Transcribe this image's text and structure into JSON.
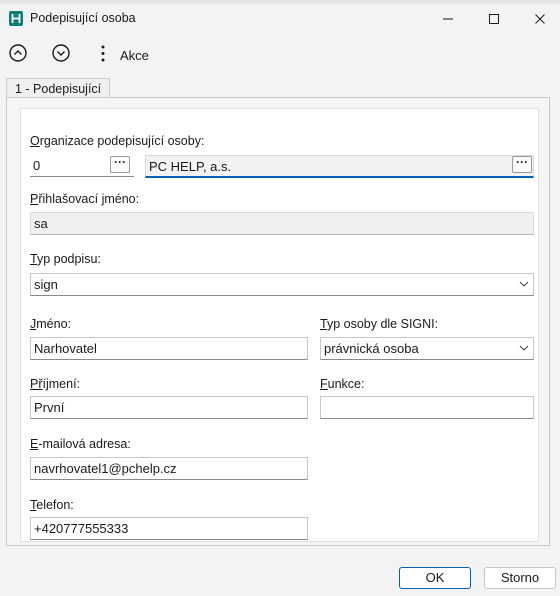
{
  "window": {
    "title": "Podepisující osoba",
    "icon": "app-logo-icon",
    "controls": [
      "minimize-icon",
      "maximize-icon",
      "close-icon"
    ]
  },
  "toolbar": {
    "up_icon": "chevron-up-circle-icon",
    "down_icon": "chevron-down-circle-icon",
    "actions_label": "Akce"
  },
  "tab": {
    "label": "1 - Podepisující"
  },
  "form": {
    "organization": {
      "label_first": "O",
      "label_rest": "rganizace podepisující osoby:",
      "code": "0",
      "name": "PC HELP, a.s.",
      "button": "···"
    },
    "login": {
      "label_first": "P",
      "label_rest": "řihlašovací jméno:",
      "value": "sa"
    },
    "signature_type": {
      "label_first": "T",
      "label_rest": "yp podpisu:",
      "value": "sign"
    },
    "first_name": {
      "label_first": "J",
      "label_rest": "méno:",
      "value": "Narhovatel"
    },
    "signi_type": {
      "label_first": "T",
      "label_rest": "yp osoby dle SIGNI:",
      "value": "právnická osoba"
    },
    "last_name": {
      "label_first": "Př",
      "label_rest": "íjmení:",
      "value": "První"
    },
    "function": {
      "label_first": "F",
      "label_rest": "unkce:",
      "value": ""
    },
    "email": {
      "label_first": "E",
      "label_rest": "-mailová adresa:",
      "value": "navrhovatel1@pchelp.cz"
    },
    "phone": {
      "label_first": "T",
      "label_rest": "elefon:",
      "value": "+420777555333"
    }
  },
  "footer": {
    "ok": "OK",
    "cancel": "Storno"
  },
  "colors": {
    "accent": "#0060b8",
    "app_icon": "#0f7e74"
  }
}
